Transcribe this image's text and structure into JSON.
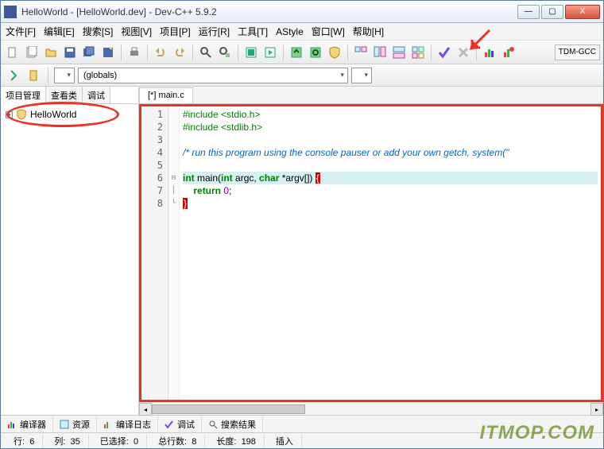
{
  "window": {
    "title": "HelloWorld - [HelloWorld.dev] - Dev-C++ 5.9.2",
    "min": "—",
    "max": "▢",
    "close": "X"
  },
  "menu": [
    "文件[F]",
    "编辑[E]",
    "搜索[S]",
    "视图[V]",
    "项目[P]",
    "运行[R]",
    "工具[T]",
    "AStyle",
    "窗口[W]",
    "帮助[H]"
  ],
  "toolbar_right": "TDM-GCC",
  "combo_scope": "(globals)",
  "side_tabs": [
    "项目管理",
    "查看类",
    "调试"
  ],
  "tree": {
    "project": "HelloWorld"
  },
  "editor_tab": "[*] main.c",
  "code_lines": [
    {
      "n": 1,
      "html": "<span class='pp'>#include &lt;stdio.h&gt;</span>"
    },
    {
      "n": 2,
      "html": "<span class='pp'>#include &lt;stdlib.h&gt;</span>"
    },
    {
      "n": 3,
      "html": ""
    },
    {
      "n": 4,
      "html": "<span class='cm'>/* run this program using the console pauser or add your own getch, system(\"</span>"
    },
    {
      "n": 5,
      "html": ""
    },
    {
      "n": 6,
      "html": "<span class='kw'>int</span> main(<span class='kw'>int</span> argc, <span class='kw'>char</span> *argv[]) <span class='br'>{</span>",
      "fold": "⊟",
      "hl": true
    },
    {
      "n": 7,
      "html": "    <span class='kw'>return</span> <span class='num'>0</span>;",
      "fold": "│"
    },
    {
      "n": 8,
      "html": "<span class='br'>}</span>",
      "fold": "└"
    }
  ],
  "bottom_tabs": [
    "编译器",
    "资源",
    "编译日志",
    "调试",
    "搜索结果"
  ],
  "status": {
    "line_lbl": "行:",
    "line": "6",
    "col_lbl": "列:",
    "col": "35",
    "sel_lbl": "已选择:",
    "sel": "0",
    "total_lbl": "总行数:",
    "total": "8",
    "len_lbl": "长度:",
    "len": "198",
    "mode": "插入"
  },
  "watermark": "ITMOP.COM"
}
